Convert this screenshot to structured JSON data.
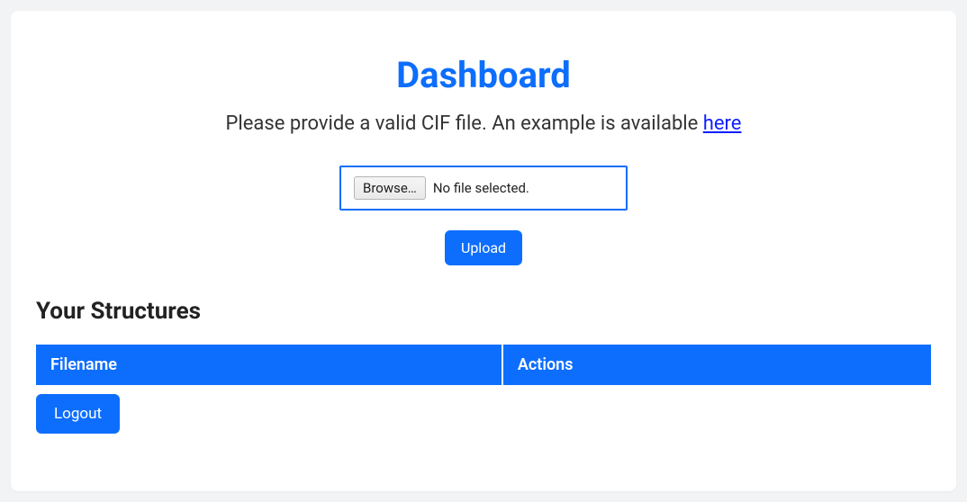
{
  "title": "Dashboard",
  "subtitle_prefix": "Please provide a valid CIF file. An example is available ",
  "subtitle_link": "here",
  "file_input": {
    "browse_label": "Browse…",
    "status": "No file selected."
  },
  "upload_label": "Upload",
  "section_title": "Your Structures",
  "table": {
    "col_filename": "Filename",
    "col_actions": "Actions"
  },
  "logout_label": "Logout"
}
